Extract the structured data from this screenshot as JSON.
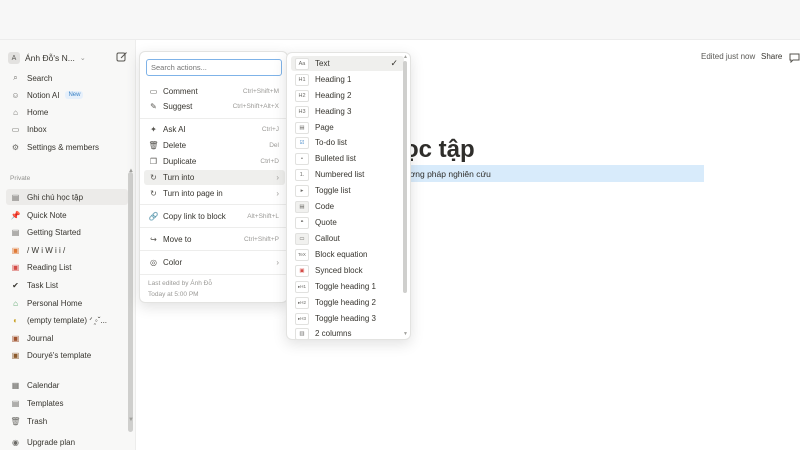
{
  "workspace": {
    "avatar": "A",
    "name": "Ánh Đỗ's N...",
    "chevron": "⌄"
  },
  "sidebar": {
    "top": [
      {
        "icon": "search-icon",
        "glyph": "⌕",
        "label": "Search"
      },
      {
        "icon": "notion-ai-icon",
        "glyph": "☺",
        "label": "Notion AI",
        "badge": "New"
      },
      {
        "icon": "home-icon",
        "glyph": "⌂",
        "label": "Home"
      },
      {
        "icon": "inbox-icon",
        "glyph": "▭",
        "label": "Inbox"
      },
      {
        "icon": "settings-icon",
        "glyph": "⚙",
        "label": "Settings & members"
      }
    ],
    "private_label": "Private",
    "pages": [
      {
        "glyph": "▤",
        "label": "Ghi chú học tập"
      },
      {
        "glyph": "📌",
        "label": "Quick Note"
      },
      {
        "glyph": "▤",
        "label": "Getting Started"
      },
      {
        "glyph": "▣",
        "label": "/ W i W i i /"
      },
      {
        "glyph": "▣",
        "label": "Reading List"
      },
      {
        "glyph": "✔",
        "label": "Task List"
      },
      {
        "glyph": "⌂",
        "label": "Personal Home"
      },
      {
        "glyph": "◐",
        "label": "(empty template) ᐟ ̯◦ˇ..."
      },
      {
        "glyph": "▣",
        "label": "Journal"
      },
      {
        "glyph": "▣",
        "label": "Douryé's template"
      }
    ],
    "bottom": [
      {
        "icon": "calendar-icon",
        "glyph": "▦",
        "label": "Calendar"
      },
      {
        "icon": "templates-icon",
        "glyph": "▤",
        "label": "Templates"
      },
      {
        "icon": "trash-icon",
        "glyph": "🗑",
        "label": "Trash"
      },
      {
        "icon": "upgrade-icon",
        "glyph": "◉",
        "label": "Upgrade plan"
      }
    ]
  },
  "header": {
    "edited": "Edited just now",
    "share": "Share"
  },
  "page": {
    "title_fragment": "ọc tập",
    "selected_text": "ương pháp nghiên cứu"
  },
  "actions_menu": {
    "search_placeholder": "Search actions...",
    "items": [
      {
        "glyph": "▭",
        "label": "Comment",
        "shortcut": "Ctrl+Shift+M"
      },
      {
        "glyph": "✎",
        "label": "Suggest",
        "shortcut": "Ctrl+Shift+Alt+X"
      },
      {
        "glyph": "✦",
        "label": "Ask AI",
        "shortcut": "Ctrl+J"
      },
      {
        "glyph": "🗑",
        "label": "Delete",
        "shortcut": "Del"
      },
      {
        "glyph": "❐",
        "label": "Duplicate",
        "shortcut": "Ctrl+D"
      },
      {
        "glyph": "↻",
        "label": "Turn into",
        "arrow": "›"
      },
      {
        "glyph": "↻",
        "label": "Turn into page in",
        "arrow": "›"
      },
      {
        "glyph": "🔗",
        "label": "Copy link to block",
        "shortcut": "Alt+Shift+L"
      },
      {
        "glyph": "↪",
        "label": "Move to",
        "shortcut": "Ctrl+Shift+P"
      },
      {
        "glyph": "◎",
        "label": "Color",
        "arrow": "›"
      }
    ],
    "footer_line1": "Last edited by Ánh Đỗ",
    "footer_line2": "Today at 5:00 PM"
  },
  "turn_into_menu": {
    "check": "✓",
    "items": [
      {
        "thumb": "Aa",
        "label": "Text"
      },
      {
        "thumb": "H1",
        "label": "Heading 1"
      },
      {
        "thumb": "H2",
        "label": "Heading 2"
      },
      {
        "thumb": "H3",
        "label": "Heading 3"
      },
      {
        "thumb": "▤",
        "label": "Page"
      },
      {
        "thumb": "☑",
        "label": "To-do list"
      },
      {
        "thumb": "•",
        "label": "Bulleted list"
      },
      {
        "thumb": "1.",
        "label": "Numbered list"
      },
      {
        "thumb": "▸",
        "label": "Toggle list"
      },
      {
        "thumb": "▤",
        "label": "Code"
      },
      {
        "thumb": "❝",
        "label": "Quote"
      },
      {
        "thumb": "▭",
        "label": "Callout"
      },
      {
        "thumb": "TeX",
        "label": "Block equation"
      },
      {
        "thumb": "▣",
        "label": "Synced block"
      },
      {
        "thumb": "▸H1",
        "label": "Toggle heading 1"
      },
      {
        "thumb": "▸H2",
        "label": "Toggle heading 2"
      },
      {
        "thumb": "▸H3",
        "label": "Toggle heading 3"
      },
      {
        "thumb": "▥",
        "label": "2 columns"
      }
    ]
  }
}
